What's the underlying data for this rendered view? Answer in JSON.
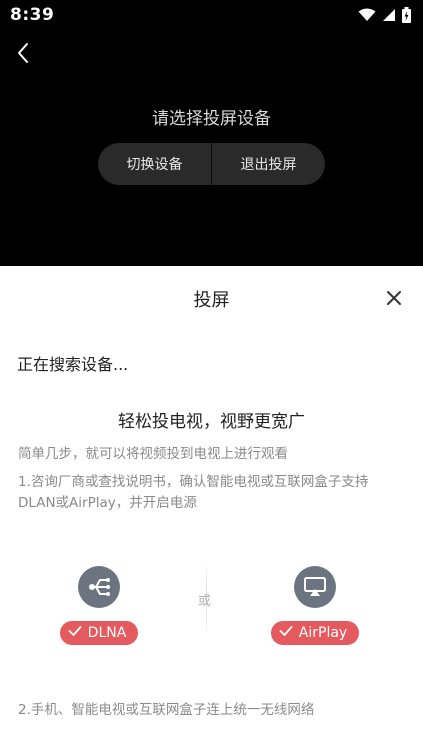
{
  "status_bar": {
    "time": "8:39"
  },
  "header": {
    "prompt": "请选择投屏设备",
    "switch_device_label": "切换设备",
    "exit_cast_label": "退出投屏"
  },
  "sheet": {
    "title": "投屏",
    "searching_text": "正在搜索设备...",
    "headline": "轻松投电视，视野更宽广",
    "subline": "简单几步，就可以将视频投到电视上进行观看",
    "step1": "1.咨询厂商或查找说明书，确认智能电视或互联网盒子支持DLAN或AirPlay，并开启电源",
    "dlna_label": "DLNA",
    "or_text": "或",
    "airplay_label": "AirPlay",
    "step2": "2.手机、智能电视或互联网盒子连上统一无线网络"
  },
  "colors": {
    "badge": "#e45a5f",
    "device_icon_bg": "#6d7481",
    "button_bg": "#2a2a2a"
  },
  "icons": [
    "wifi-icon",
    "signal-icon",
    "battery-icon",
    "back-arrow-icon",
    "close-icon",
    "dlna-share-icon",
    "airplay-icon",
    "check-icon"
  ]
}
